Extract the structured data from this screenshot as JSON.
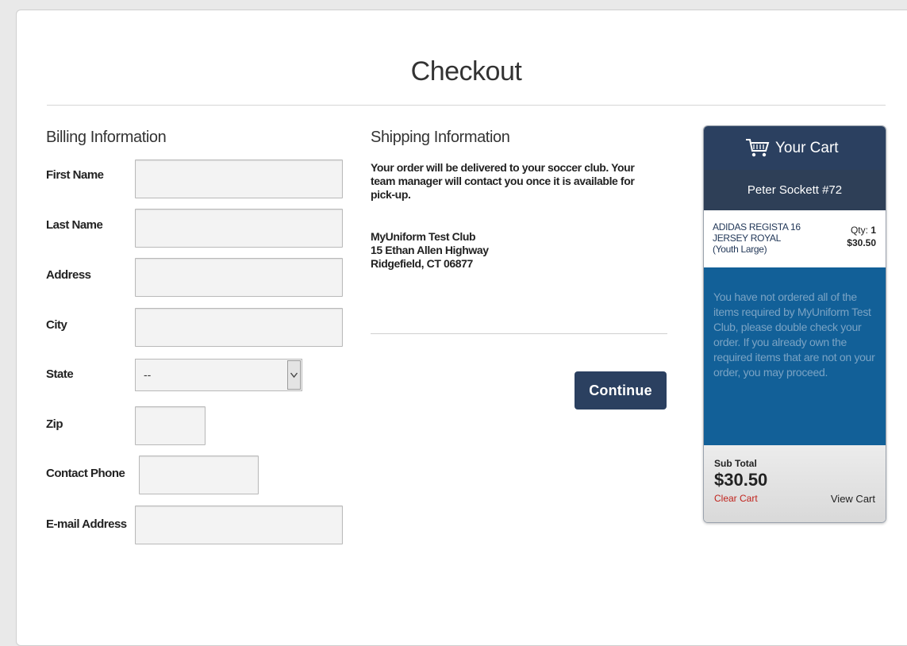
{
  "page": {
    "title": "Checkout"
  },
  "billing": {
    "heading": "Billing Information",
    "fields": {
      "first_name": {
        "label": "First Name",
        "value": ""
      },
      "last_name": {
        "label": "Last Name",
        "value": ""
      },
      "address": {
        "label": "Address",
        "value": ""
      },
      "city": {
        "label": "City",
        "value": ""
      },
      "state": {
        "label": "State",
        "value": "--"
      },
      "zip": {
        "label": "Zip",
        "value": ""
      },
      "phone": {
        "label": "Contact Phone",
        "value": ""
      },
      "email": {
        "label": "E-mail Address",
        "value": ""
      }
    }
  },
  "shipping": {
    "heading": "Shipping Information",
    "notice_lines": [
      "Your order will be delivered to your soccer club. Your",
      "team manager will contact you once it is available for",
      "pick-up."
    ],
    "address_lines": [
      "MyUniform Test Club",
      "15 Ethan Allen Highway",
      "Ridgefield, CT 06877"
    ],
    "continue_label": "Continue"
  },
  "cart": {
    "title": "Your Cart",
    "owner": "Peter Sockett #72",
    "item": {
      "name_lines": [
        "ADIDAS REGISTA 16",
        "JERSEY ROYAL",
        "(Youth Large)"
      ],
      "qty_label": "Qty:",
      "qty": "1",
      "price": "$30.50"
    },
    "warning": "You have not ordered all of the items required by MyUniform Test Club, please double check your order. If you already own the required items that are not on your order, you may proceed.",
    "subtotal_label": "Sub Total",
    "subtotal": "$30.50",
    "clear_label": "Clear Cart",
    "view_label": "View Cart"
  },
  "colors": {
    "navy": "#2b4060",
    "warning_blue": "#126098",
    "clear_red": "#c0231c"
  }
}
